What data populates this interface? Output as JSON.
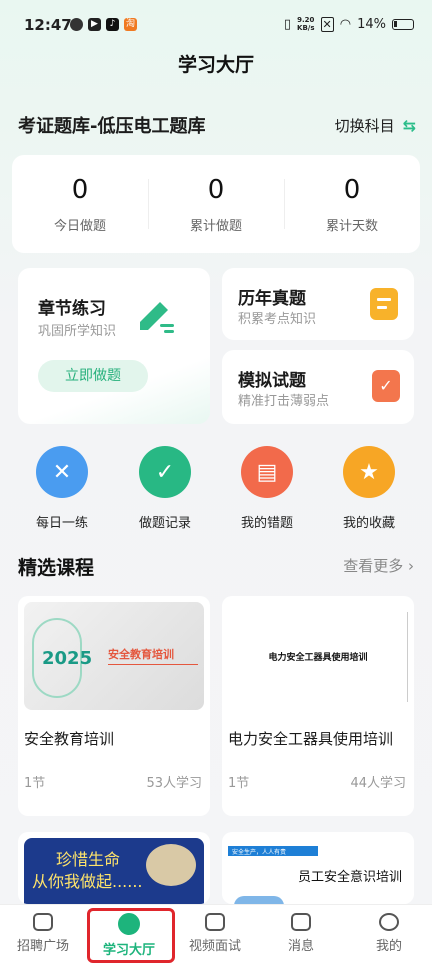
{
  "status": {
    "time": "12:47",
    "net_speed_top": "9.20",
    "net_speed_unit": "KB/s",
    "battery": "14%"
  },
  "page_title": "学习大厅",
  "bank": {
    "title": "考证题库-低压电工题库",
    "switch_label": "切换科目"
  },
  "stats": [
    {
      "value": "0",
      "label": "今日做题"
    },
    {
      "value": "0",
      "label": "累计做题"
    },
    {
      "value": "0",
      "label": "累计天数"
    }
  ],
  "practice": {
    "chapter": {
      "title": "章节练习",
      "subtitle": "巩固所学知识",
      "cta": "立即做题"
    },
    "history": {
      "title": "历年真题",
      "subtitle": "积累考点知识"
    },
    "mock": {
      "title": "模拟试题",
      "subtitle": "精准打击薄弱点"
    }
  },
  "quick_actions": [
    {
      "label": "每日一练",
      "icon": "pencil-ruler-icon",
      "color": "#4a9cf0"
    },
    {
      "label": "做题记录",
      "icon": "clipboard-check-icon",
      "color": "#28b884"
    },
    {
      "label": "我的错题",
      "icon": "folder-x-icon",
      "color": "#f26a4b"
    },
    {
      "label": "我的收藏",
      "icon": "bookmark-star-icon",
      "color": "#f7a625"
    }
  ],
  "courses_section": {
    "title": "精选课程",
    "more": "查看更多"
  },
  "courses": [
    {
      "name": "安全教育培训",
      "sections": "1节",
      "learners": "53人学习",
      "thumb_year": "2025",
      "thumb_title": "安全教育培训"
    },
    {
      "name": "电力安全工器具使用培训",
      "sections": "1节",
      "learners": "44人学习",
      "thumb_title": "电力安全工器具使用培训"
    },
    {
      "thumb_line1": "珍惜生命",
      "thumb_line2": "从你我做起......"
    },
    {
      "thumb_tag": "安全生产，人人有责",
      "thumb_title": "员工安全意识培训"
    }
  ],
  "bottom_nav": [
    {
      "label": "招聘广场"
    },
    {
      "label": "学习大厅"
    },
    {
      "label": "视频面试"
    },
    {
      "label": "消息"
    },
    {
      "label": "我的"
    }
  ]
}
